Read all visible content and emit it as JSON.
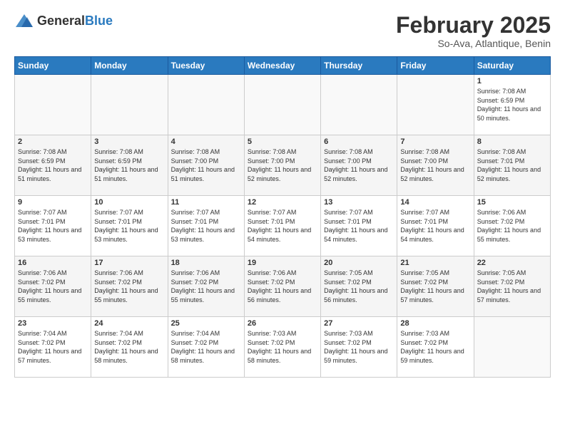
{
  "logo": {
    "general": "General",
    "blue": "Blue"
  },
  "title": "February 2025",
  "subtitle": "So-Ava, Atlantique, Benin",
  "days_of_week": [
    "Sunday",
    "Monday",
    "Tuesday",
    "Wednesday",
    "Thursday",
    "Friday",
    "Saturday"
  ],
  "weeks": [
    [
      {
        "day": "",
        "info": ""
      },
      {
        "day": "",
        "info": ""
      },
      {
        "day": "",
        "info": ""
      },
      {
        "day": "",
        "info": ""
      },
      {
        "day": "",
        "info": ""
      },
      {
        "day": "",
        "info": ""
      },
      {
        "day": "1",
        "info": "Sunrise: 7:08 AM\nSunset: 6:59 PM\nDaylight: 11 hours and 50 minutes."
      }
    ],
    [
      {
        "day": "2",
        "info": "Sunrise: 7:08 AM\nSunset: 6:59 PM\nDaylight: 11 hours and 51 minutes."
      },
      {
        "day": "3",
        "info": "Sunrise: 7:08 AM\nSunset: 6:59 PM\nDaylight: 11 hours and 51 minutes."
      },
      {
        "day": "4",
        "info": "Sunrise: 7:08 AM\nSunset: 7:00 PM\nDaylight: 11 hours and 51 minutes."
      },
      {
        "day": "5",
        "info": "Sunrise: 7:08 AM\nSunset: 7:00 PM\nDaylight: 11 hours and 52 minutes."
      },
      {
        "day": "6",
        "info": "Sunrise: 7:08 AM\nSunset: 7:00 PM\nDaylight: 11 hours and 52 minutes."
      },
      {
        "day": "7",
        "info": "Sunrise: 7:08 AM\nSunset: 7:00 PM\nDaylight: 11 hours and 52 minutes."
      },
      {
        "day": "8",
        "info": "Sunrise: 7:08 AM\nSunset: 7:01 PM\nDaylight: 11 hours and 52 minutes."
      }
    ],
    [
      {
        "day": "9",
        "info": "Sunrise: 7:07 AM\nSunset: 7:01 PM\nDaylight: 11 hours and 53 minutes."
      },
      {
        "day": "10",
        "info": "Sunrise: 7:07 AM\nSunset: 7:01 PM\nDaylight: 11 hours and 53 minutes."
      },
      {
        "day": "11",
        "info": "Sunrise: 7:07 AM\nSunset: 7:01 PM\nDaylight: 11 hours and 53 minutes."
      },
      {
        "day": "12",
        "info": "Sunrise: 7:07 AM\nSunset: 7:01 PM\nDaylight: 11 hours and 54 minutes."
      },
      {
        "day": "13",
        "info": "Sunrise: 7:07 AM\nSunset: 7:01 PM\nDaylight: 11 hours and 54 minutes."
      },
      {
        "day": "14",
        "info": "Sunrise: 7:07 AM\nSunset: 7:01 PM\nDaylight: 11 hours and 54 minutes."
      },
      {
        "day": "15",
        "info": "Sunrise: 7:06 AM\nSunset: 7:02 PM\nDaylight: 11 hours and 55 minutes."
      }
    ],
    [
      {
        "day": "16",
        "info": "Sunrise: 7:06 AM\nSunset: 7:02 PM\nDaylight: 11 hours and 55 minutes."
      },
      {
        "day": "17",
        "info": "Sunrise: 7:06 AM\nSunset: 7:02 PM\nDaylight: 11 hours and 55 minutes."
      },
      {
        "day": "18",
        "info": "Sunrise: 7:06 AM\nSunset: 7:02 PM\nDaylight: 11 hours and 55 minutes."
      },
      {
        "day": "19",
        "info": "Sunrise: 7:06 AM\nSunset: 7:02 PM\nDaylight: 11 hours and 56 minutes."
      },
      {
        "day": "20",
        "info": "Sunrise: 7:05 AM\nSunset: 7:02 PM\nDaylight: 11 hours and 56 minutes."
      },
      {
        "day": "21",
        "info": "Sunrise: 7:05 AM\nSunset: 7:02 PM\nDaylight: 11 hours and 57 minutes."
      },
      {
        "day": "22",
        "info": "Sunrise: 7:05 AM\nSunset: 7:02 PM\nDaylight: 11 hours and 57 minutes."
      }
    ],
    [
      {
        "day": "23",
        "info": "Sunrise: 7:04 AM\nSunset: 7:02 PM\nDaylight: 11 hours and 57 minutes."
      },
      {
        "day": "24",
        "info": "Sunrise: 7:04 AM\nSunset: 7:02 PM\nDaylight: 11 hours and 58 minutes."
      },
      {
        "day": "25",
        "info": "Sunrise: 7:04 AM\nSunset: 7:02 PM\nDaylight: 11 hours and 58 minutes."
      },
      {
        "day": "26",
        "info": "Sunrise: 7:03 AM\nSunset: 7:02 PM\nDaylight: 11 hours and 58 minutes."
      },
      {
        "day": "27",
        "info": "Sunrise: 7:03 AM\nSunset: 7:02 PM\nDaylight: 11 hours and 59 minutes."
      },
      {
        "day": "28",
        "info": "Sunrise: 7:03 AM\nSunset: 7:02 PM\nDaylight: 11 hours and 59 minutes."
      },
      {
        "day": "",
        "info": ""
      }
    ]
  ]
}
